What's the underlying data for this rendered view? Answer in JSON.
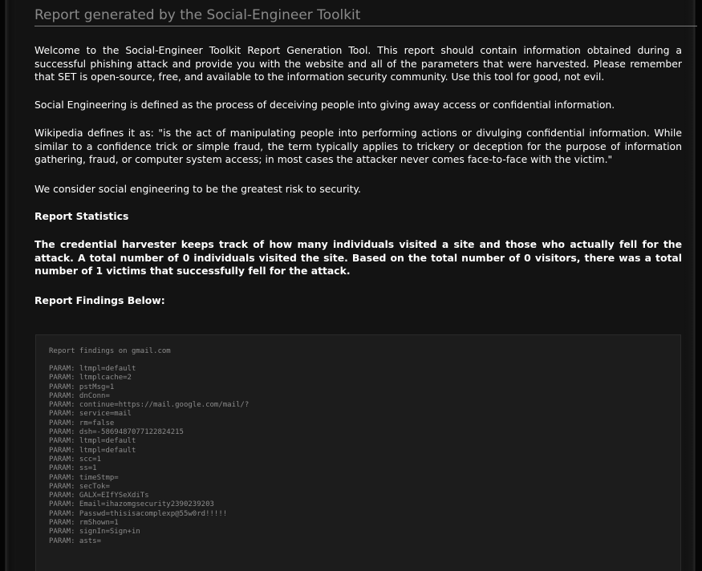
{
  "report": {
    "heading": "Report generated by the Social-Engineer Toolkit",
    "intro": "Welcome to the Social-Engineer Toolkit Report Generation Tool. This report should contain information obtained during a successful phishing attack and provide you with the website and all of the parameters that were harvested. Please remember that SET is open-source, free, and available to the information security community. Use this tool for good, not evil.",
    "definition": "Social Engineering is defined as the process of deceiving people into giving away access or confidential information.",
    "wikipedia": "Wikipedia defines it as: \"is the act of manipulating people into performing actions or divulging confidential information. While similar to a confidence trick or simple fraud, the term typically applies to trickery or deception for the purpose of information gathering, fraud, or computer system access; in most cases the attacker never comes face-to-face with the victim.\"",
    "risk": "We consider social engineering to be the greatest risk to security.",
    "stats_title": "Report Statistics",
    "stats_text": "The credential harvester keeps track of how many individuals visited a site and those who actually fell for the attack. A total number of 0 individuals visited the site. Based on the total number of 0 visitors, there was a total number of 1 victims that successfully fell for the attack.",
    "findings_title": "Report Findings Below:"
  },
  "findings": {
    "header": "Report findings on gmail.com",
    "params": [
      "PARAM: ltmpl=default",
      "PARAM: ltmplcache=2",
      "PARAM: pstMsg=1",
      "PARAM: dnConn=",
      "PARAM: continue=https://mail.google.com/mail/?",
      "PARAM: service=mail",
      "PARAM: rm=false",
      "PARAM: dsh=-5869487077122824215",
      "PARAM: ltmpl=default",
      "PARAM: ltmpl=default",
      "PARAM: scc=1",
      "PARAM: ss=1",
      "PARAM: timeStmp=",
      "PARAM: secTok=",
      "PARAM: GALX=EIfYSeXdiTs",
      "PARAM: Email=ihazomgsecurity2390239203",
      "PARAM: Passwd=thisisacomplexp@55w0rd!!!!!",
      "PARAM: rmShown=1",
      "PARAM: signIn=Sign+in",
      "PARAM: asts="
    ]
  },
  "colors": {
    "background": "#131313",
    "heading": "#8a8a8a",
    "text": "#ffffff",
    "findings_bg": "#1c1c1c",
    "findings_text": "#8c8c8c"
  }
}
